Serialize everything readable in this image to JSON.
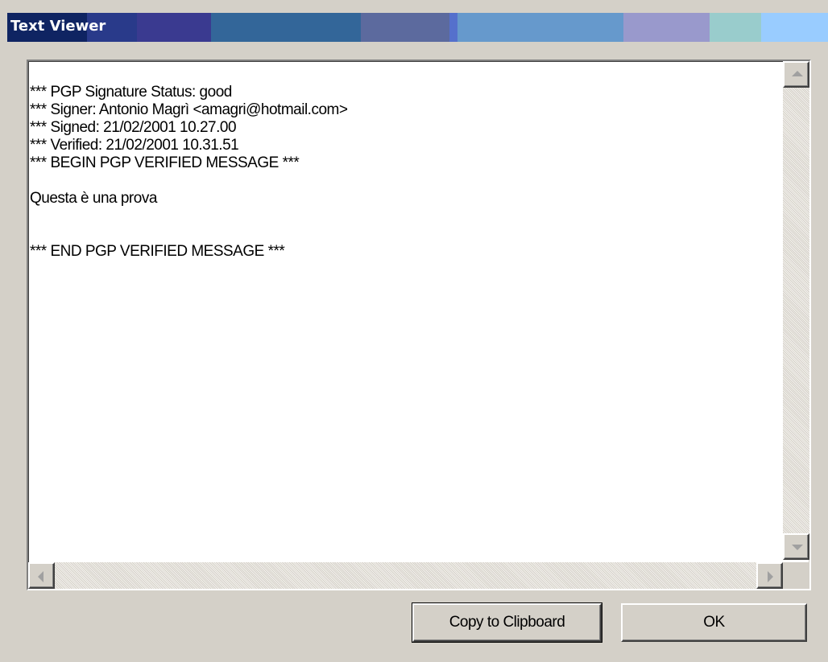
{
  "window": {
    "title": "Text Viewer",
    "title_colors": [
      "#0f2462",
      "#3a3a90",
      "#336699",
      "#5c6a9e",
      "#6699cc",
      "#9999cc",
      "#99cccc",
      "#99ccff"
    ]
  },
  "viewer": {
    "lines": [
      "*** PGP Signature Status: good",
      "*** Signer: Antonio Magrì <amagri@hotmail.com>",
      "*** Signed: 21/02/2001 10.27.00",
      "*** Verified: 21/02/2001 10.31.51",
      "*** BEGIN PGP VERIFIED MESSAGE ***",
      "",
      "Questa è una prova",
      "",
      "",
      "*** END PGP VERIFIED MESSAGE ***"
    ]
  },
  "buttons": {
    "copy_label": "Copy to Clipboard",
    "ok_label": "OK"
  }
}
